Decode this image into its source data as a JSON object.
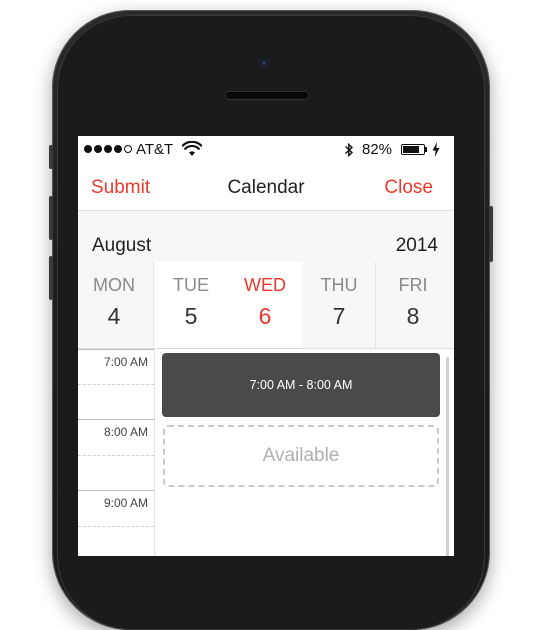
{
  "status_bar": {
    "carrier": "AT&T",
    "battery_percent": "82%",
    "battery_level": 0.82,
    "signal_bars_filled": 4,
    "signal_bars_total": 5
  },
  "nav": {
    "left_label": "Submit",
    "title": "Calendar",
    "right_label": "Close"
  },
  "header": {
    "month": "August",
    "year": "2014"
  },
  "days": [
    {
      "name": "MON",
      "number": "4"
    },
    {
      "name": "TUE",
      "number": "5"
    },
    {
      "name": "WED",
      "number": "6"
    },
    {
      "name": "THU",
      "number": "7"
    },
    {
      "name": "FRI",
      "number": "8"
    }
  ],
  "selected_day_index": 2,
  "times": [
    "7:00 AM",
    "8:00 AM",
    "9:00 AM"
  ],
  "event": {
    "label": "7:00 AM - 8:00 AM"
  },
  "available": {
    "label": "Available"
  },
  "colors": {
    "accent": "#e8392d",
    "event_bg": "#4a4a4a",
    "header_bg": "#f7f7f7"
  }
}
